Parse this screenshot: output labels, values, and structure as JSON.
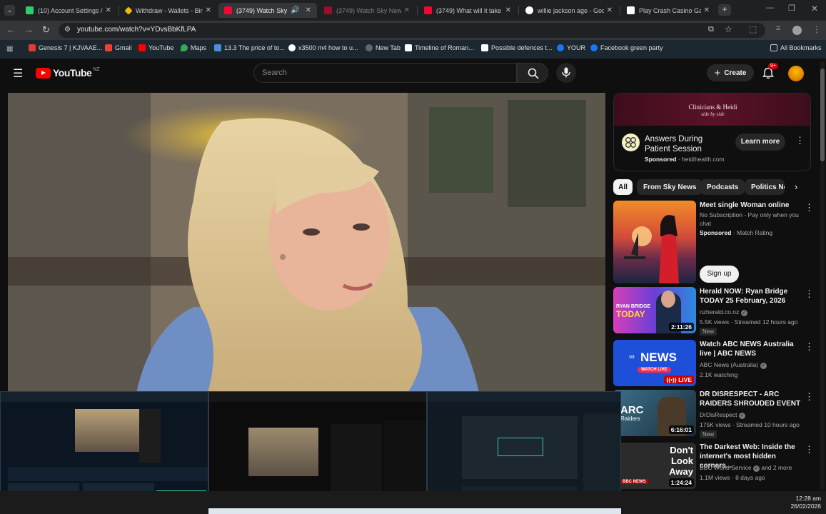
{
  "browser": {
    "tabs": [
      {
        "title": "(10) Account Settings / S",
        "favicon_color": "#2ecc71",
        "active": false
      },
      {
        "title": "Withdraw - Wallets - Bin",
        "favicon_color": "#f0b90b",
        "active": false
      },
      {
        "title": "(3749) Watch Sky Ne",
        "favicon_color": "#ff0033",
        "active": true
      },
      {
        "title": "(3749) Watch Sky News",
        "favicon_color": "#ff0033",
        "active": false
      },
      {
        "title": "(3749) What will it take t",
        "favicon_color": "#ff0033",
        "active": false
      },
      {
        "title": "willie jackson age - Goo",
        "favicon_color": "#ffffff",
        "active": false
      },
      {
        "title": "Play Crash Casino Game",
        "favicon_color": "#ffffff",
        "active": false
      }
    ],
    "new_tab_label": "+",
    "url": "youtube.com/watch?v=YDvsBbKfLPA",
    "bookmarks": [
      {
        "label": "Genesis 7 | KJVAAE...",
        "color": "#e53935"
      },
      {
        "label": "Gmail",
        "color": "#ea4335"
      },
      {
        "label": "YouTube",
        "color": "#ff0000"
      },
      {
        "label": "Maps",
        "color": "#34a853"
      },
      {
        "label": "13.3 The price of to...",
        "color": "#4a90d9"
      },
      {
        "label": "x3500 m4 how to u...",
        "color": "#ffffff"
      },
      {
        "label": "New Tab",
        "color": "#888888"
      },
      {
        "label": "Timeline of Roman...",
        "color": "#ffffff"
      },
      {
        "label": "Possible defences t...",
        "color": "#ffffff"
      },
      {
        "label": "YOUR",
        "color": "#1877f2"
      },
      {
        "label": "Facebook green party",
        "color": "#1877f2"
      }
    ],
    "all_bookmarks": "All Bookmarks"
  },
  "youtube": {
    "logo_text": "YouTube",
    "region": "NZ",
    "search_placeholder": "Search",
    "create_label": "Create",
    "notifications": "9+",
    "brand_color": "#ff0000"
  },
  "ad": {
    "banner_text": "Clinicians & Heidi",
    "banner_subtext": "side by side",
    "title": "Answers During Patient Session",
    "sponsored": "Sponsored",
    "domain": "heidihealth.com",
    "cta": "Learn more"
  },
  "chips": [
    {
      "label": "All",
      "selected": true
    },
    {
      "label": "From Sky News",
      "selected": false
    },
    {
      "label": "Podcasts",
      "selected": false
    },
    {
      "label": "Politics Ne",
      "selected": false
    }
  ],
  "related": [
    {
      "title": "Meet single Woman online",
      "line1": "No Subscription - Pay only when you chat",
      "sponsored": "Sponsored",
      "channel": "Match Rating",
      "cta": "Sign up",
      "duration": ""
    },
    {
      "title": "Herald NOW: Ryan Bridge TODAY 25 February, 2026",
      "channel": "nzherald.co.nz",
      "meta": "5.5K views · Streamed 12 hours ago",
      "badge": "New",
      "duration": "2:11:26",
      "thumb_text": "RYAN BRIDGE",
      "thumb_text2": "TODAY"
    },
    {
      "title": "Watch ABC NEWS Australia live | ABC NEWS",
      "channel": "ABC News (Australia)",
      "meta": "2.1K watching",
      "duration": "LIVE",
      "thumb_text": "NEWS",
      "thumb_text2": "WATCH LIVE"
    },
    {
      "title": "DR DISRESPECT - ARC RAIDERS SHROUDED EVENT",
      "channel": "DrDisRespect",
      "meta": "175K views · Streamed 10 hours ago",
      "badge": "New",
      "duration": "6:16:01",
      "thumb_text": "ARC",
      "thumb_text2": "Raiders"
    },
    {
      "title": "The Darkest Web: Inside the internet's most hidden corners...",
      "channel": "BBC World Service",
      "channel_extra": "and 2 more",
      "meta": "1.1M views · 8 days ago",
      "duration": "1:24:24",
      "thumb_text": "Don't Look Away",
      "thumb_text2": "BBC NEWS"
    }
  ],
  "taskbar": {
    "time": "12:28 am",
    "date": "26/02/2026"
  }
}
